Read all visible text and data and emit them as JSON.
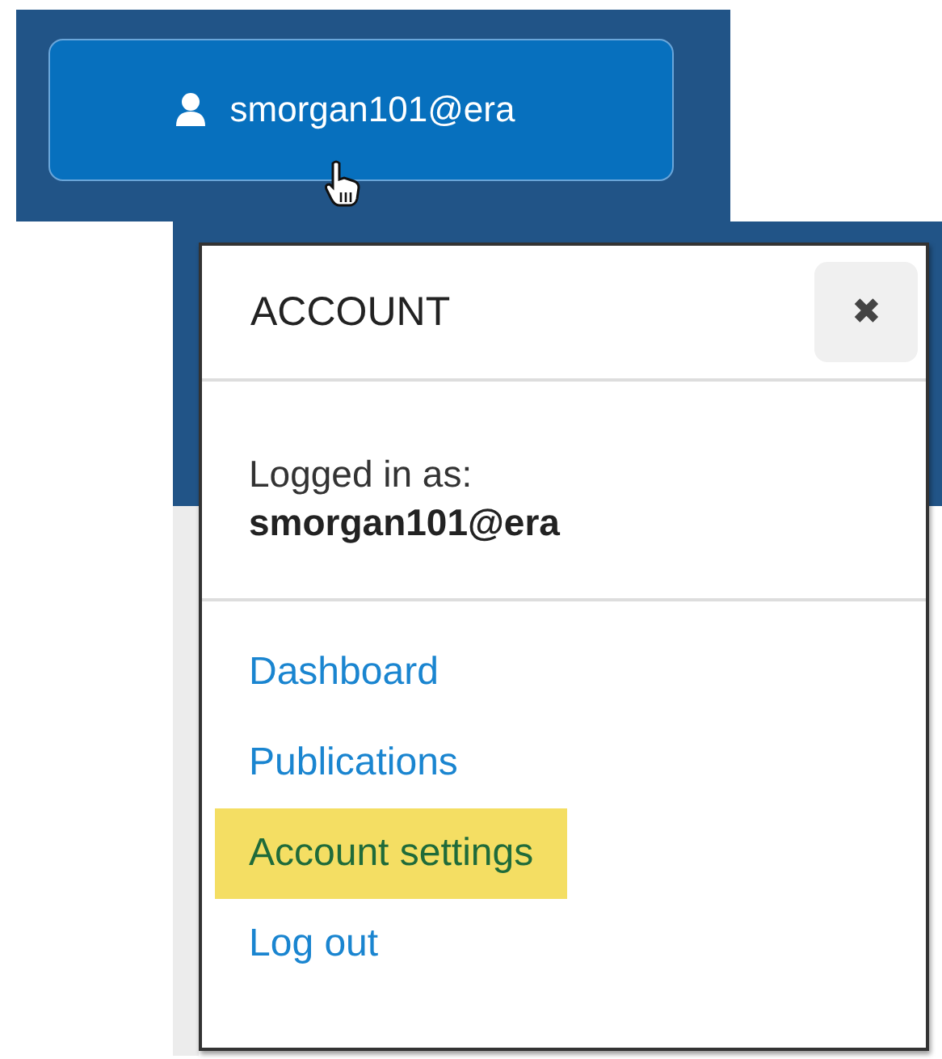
{
  "account_button": {
    "label": "smorgan101@era"
  },
  "popup": {
    "title": "ACCOUNT",
    "close": "✖",
    "logged_in_label": "Logged in as:",
    "username": "smorgan101@era",
    "links": [
      {
        "label": "Dashboard",
        "selected": false
      },
      {
        "label": "Publications",
        "selected": false
      },
      {
        "label": "Account settings",
        "selected": true
      },
      {
        "label": "Log out",
        "selected": false
      }
    ]
  }
}
